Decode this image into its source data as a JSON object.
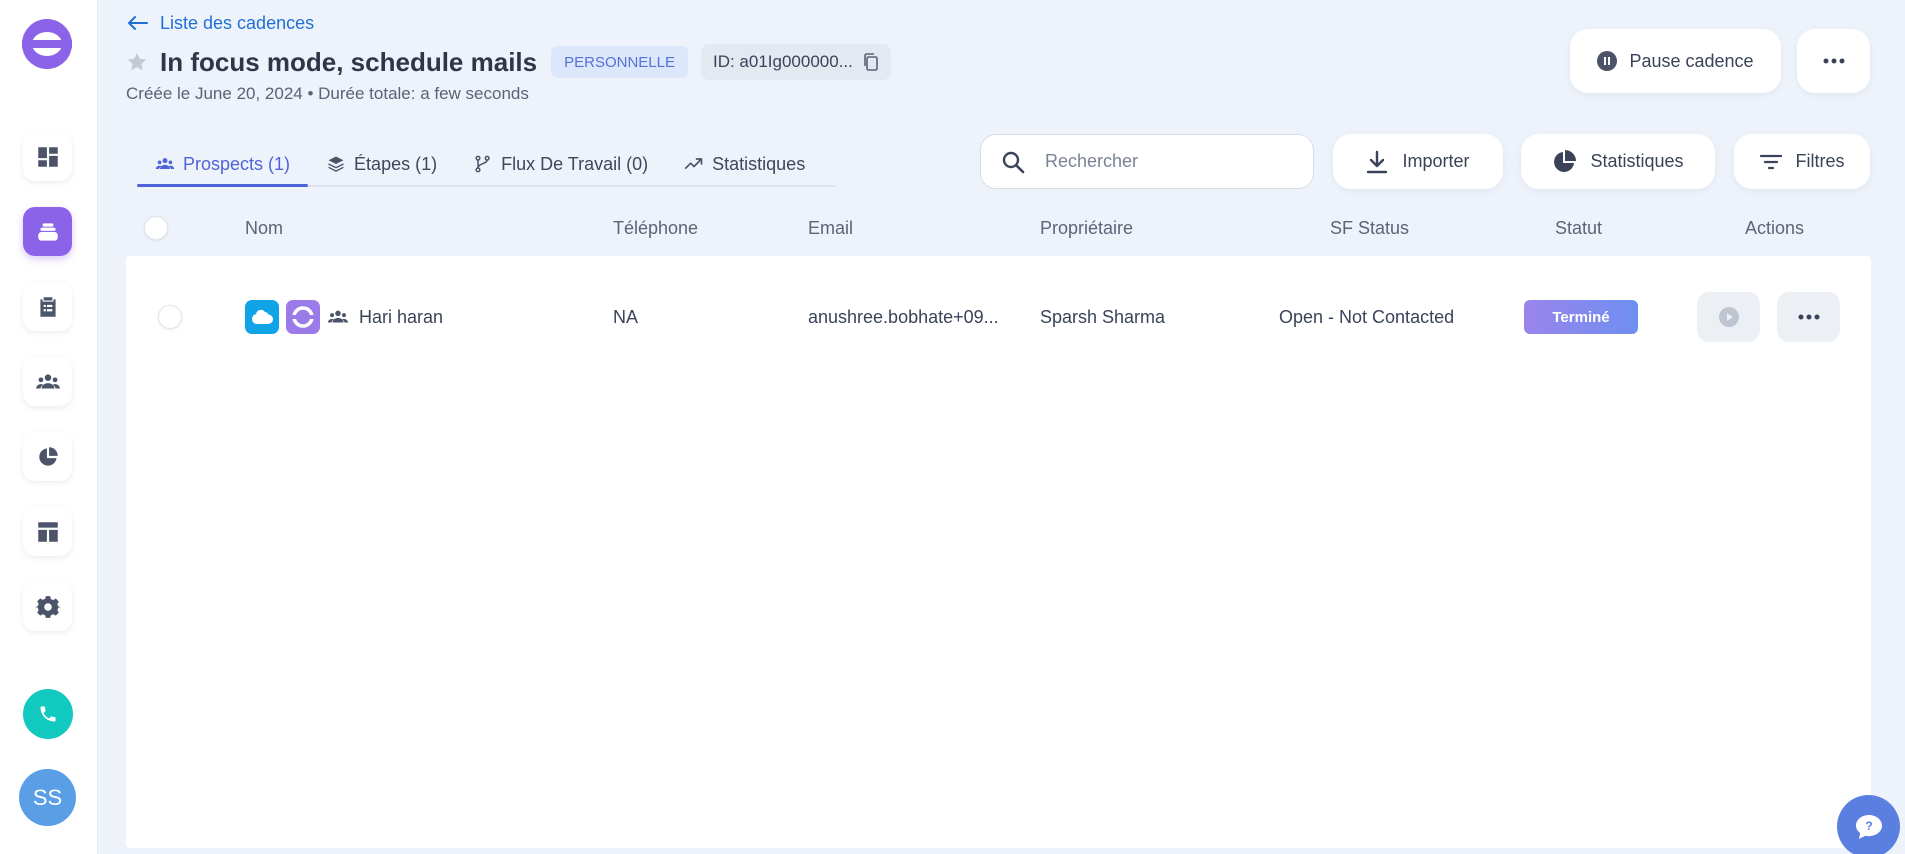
{
  "header": {
    "back_label": "Liste des cadences",
    "title": "In focus mode, schedule mails",
    "badge": "PERSONNELLE",
    "id_label": "ID: a01Ig000000...",
    "subtitle": "Créée le June 20, 2024 • Durée totale: a few seconds",
    "pause_label": "Pause cadence"
  },
  "tabs": [
    {
      "label": "Prospects (1)",
      "icon": "people-icon",
      "active": true
    },
    {
      "label": "Étapes (1)",
      "icon": "layers-icon",
      "active": false
    },
    {
      "label": "Flux De Travail (0)",
      "icon": "workflow-icon",
      "active": false
    },
    {
      "label": "Statistiques",
      "icon": "trend-icon",
      "active": false
    }
  ],
  "toolbar": {
    "search_placeholder": "Rechercher",
    "import_label": "Importer",
    "stats_label": "Statistiques",
    "filters_label": "Filtres"
  },
  "table": {
    "columns": [
      "Nom",
      "Téléphone",
      "Email",
      "Propriétaire",
      "SF Status",
      "Statut",
      "Actions"
    ],
    "rows": [
      {
        "name": "Hari haran",
        "phone": "NA",
        "email": "anushree.bobhate+09...",
        "owner": "Sparsh Sharma",
        "sf_status": "Open - Not Contacted",
        "status": "Terminé"
      }
    ]
  },
  "user": {
    "initials": "SS"
  },
  "colors": {
    "accent": "#8a63e8",
    "link": "#1f6fd6",
    "tab_active": "#4e63d8",
    "phone": "#12c9c0",
    "salesforce": "#10a3e6"
  }
}
